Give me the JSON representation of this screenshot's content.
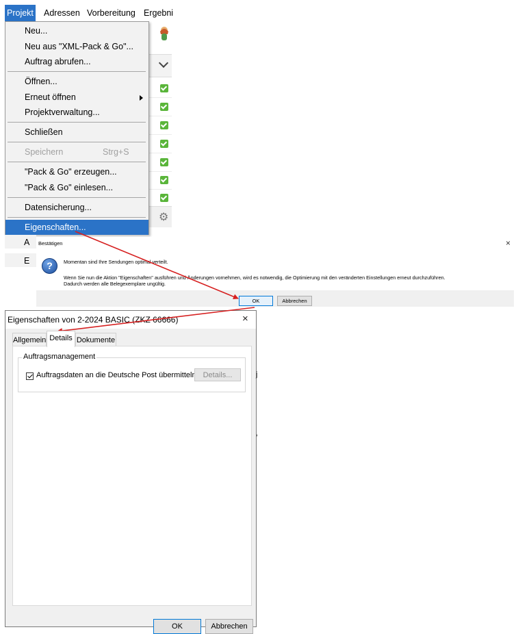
{
  "menubar": {
    "items": [
      {
        "label": "Projekt",
        "active": true
      },
      {
        "label": "Adressen"
      },
      {
        "label": "Vorbereitung"
      },
      {
        "label": "Ergebni"
      }
    ]
  },
  "menu": {
    "items": [
      {
        "label": "Neu..."
      },
      {
        "label": "Neu aus \"XML-Pack & Go\"..."
      },
      {
        "label": "Auftrag abrufen..."
      },
      {
        "label": "Öffnen..."
      },
      {
        "label": "Erneut öffnen"
      },
      {
        "label": "Projektverwaltung..."
      },
      {
        "label": "Schließen"
      },
      {
        "label": "Speichern",
        "shortcut": "Strg+S",
        "disabled": true
      },
      {
        "label": "\"Pack & Go\" erzeugen..."
      },
      {
        "label": "\"Pack & Go\" einlesen..."
      },
      {
        "label": "Datensicherung..."
      },
      {
        "label": "Eigenschaften...",
        "highlighted": true
      },
      {
        "label": "A"
      },
      {
        "label": "E"
      }
    ]
  },
  "confirm": {
    "title": "Bestätigen",
    "close": "×",
    "line1": "Momentan sind Ihre Sendungen optimal verteilt.",
    "line2": "Wenn Sie nun die Aktion \"Eigenschaften\" ausführen und Änderungen vornehmen, wird es notwendig, die Optimierung mit den veränderten Einstellungen erneut durchzuführen.",
    "line3": "Dadurch werden alle Belegexemplare ungültig.",
    "ok": "OK",
    "cancel": "Abbrechen"
  },
  "props": {
    "title": "Eigenschaften von 2-2024 BASIC  (ZKZ 66666)",
    "close": "×",
    "tabs": [
      {
        "label": "Allgemein"
      },
      {
        "label": "Details",
        "active": true
      },
      {
        "label": "Dokumente"
      }
    ],
    "group_label": "Auftragsmanagement",
    "checkbox_label": "Auftragsdaten an die Deutsche Post übermitteln",
    "checkbox_checked": true,
    "details_button": "Details...",
    "ok": "OK",
    "cancel": "Abbrechen"
  },
  "colors": {
    "highlight": "#2b73c7",
    "arrow": "#d62020",
    "check_green": "#5ab53a"
  },
  "icons": {
    "question": "question-icon",
    "check": "checkmark-icon",
    "gear": "gear-icon",
    "submenu": "submenu-arrow-icon"
  }
}
